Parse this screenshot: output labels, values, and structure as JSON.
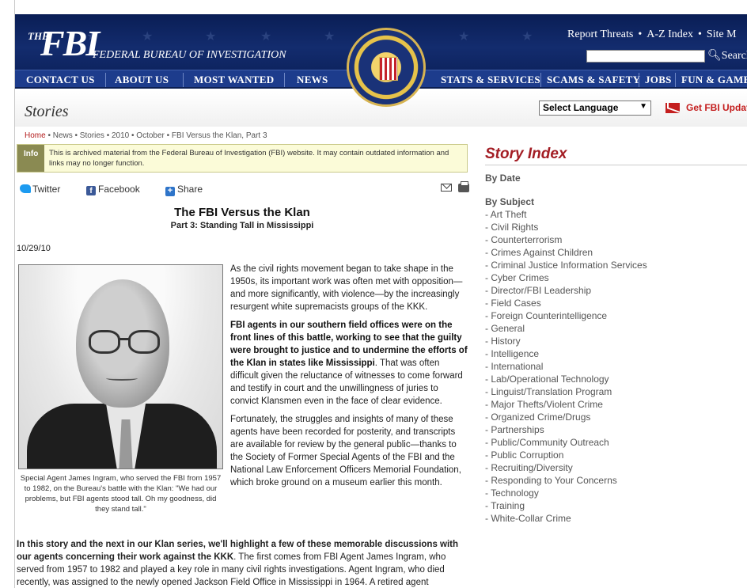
{
  "header": {
    "logo_the": "THE",
    "logo_fbi": "FBI",
    "logo_sub": "FEDERAL BUREAU OF INVESTIGATION",
    "top_links": [
      "Report Threats",
      "A-Z Index",
      "Site M"
    ],
    "search_label": "Search"
  },
  "nav": {
    "left": [
      "CONTACT US",
      "ABOUT US",
      "MOST WANTED",
      "NEWS"
    ],
    "right": [
      "STATS & SERVICES",
      "SCAMS & SAFETY",
      "JOBS",
      "FUN & GAME"
    ]
  },
  "subhead": {
    "title": "Stories",
    "language_select": "Select Language",
    "updates_link": "Get FBI Update"
  },
  "breadcrumb": {
    "home": "Home",
    "rest": " • News • Stories • 2010 • October • FBI Versus the Klan, Part 3"
  },
  "info": {
    "tag": "Info",
    "text": "This is archived material from the Federal Bureau of Investigation (FBI) website. It may contain outdated information and links may no longer function."
  },
  "share": {
    "twitter": "Twitter",
    "facebook": "Facebook",
    "share": "Share"
  },
  "article": {
    "title": "The FBI Versus the Klan",
    "subtitle": "Part 3: Standing Tall in Mississippi",
    "date": "10/29/10",
    "caption": "Special Agent James Ingram, who served the FBI from 1957 to 1982, on the Bureau's battle with the Klan: \"We had our problems, but FBI agents stood tall. Oh my goodness, did they stand tall.\"",
    "p1": "As the civil rights movement began to take shape in the 1950s, its important work was often met with opposition—and more significantly, with violence—by the increasingly resurgent white supremacists groups of the KKK.",
    "p2_bold": "FBI agents in our southern field offices were on the front lines of this battle, working to see that the guilty were brought to justice and to undermine the efforts of the Klan in states like Mississippi",
    "p2_rest": ". That was often difficult given the reluctance of witnesses to come forward and testify in court and the unwillingness of juries to convict Klansmen even in the face of clear evidence.",
    "p3": "Fortunately, the struggles and insights of many of these agents have been recorded for posterity, and transcripts are available for review by the general public—thanks to the Society of Former Special Agents of the FBI and the National Law Enforcement Officers Memorial Foundation, which broke ground on a museum earlier this month.",
    "p4_bold": "In this story and the next in our Klan series, we'll highlight a few of these memorable discussions with our agents concerning their work against the KKK",
    "p4_rest": ". The first comes from FBI Agent James Ingram, who served from 1957 to 1982 and played a key role in many civil rights investigations. Agent Ingram, who died recently, was assigned to the newly opened Jackson Field Office in Mississippi in 1964. A retired agent"
  },
  "sidebar": {
    "title": "Story Index",
    "by_date": "By Date",
    "by_subject": "By Subject",
    "subjects": [
      "- Art Theft",
      "- Civil Rights",
      "- Counterterrorism",
      "- Crimes Against Children",
      "- Criminal Justice Information Services",
      "- Cyber Crimes",
      "- Director/FBI Leadership",
      "- Field Cases",
      "- Foreign Counterintelligence",
      "- General",
      "- History",
      "- Intelligence",
      "- International",
      "- Lab/Operational Technology",
      "- Linguist/Translation Program",
      "- Major Thefts/Violent Crime",
      "- Organized Crime/Drugs",
      "- Partnerships",
      "- Public/Community Outreach",
      "- Public Corruption",
      "- Recruiting/Diversity",
      "- Responding to Your Concerns",
      "- Technology",
      "- Training",
      "- White-Collar Crime"
    ]
  }
}
